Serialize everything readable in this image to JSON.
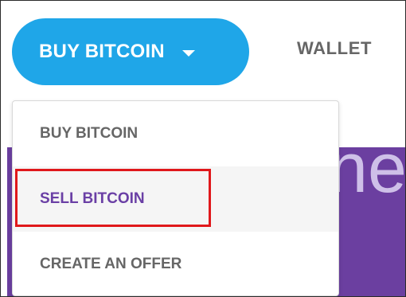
{
  "header": {
    "buy_button_label": "BUY BITCOIN",
    "wallet_label": "WALLET"
  },
  "dropdown": {
    "items": [
      {
        "label": "BUY BITCOIN"
      },
      {
        "label": "SELL BITCOIN"
      },
      {
        "label": "CREATE AN OFFER"
      }
    ],
    "highlighted_index": 1
  },
  "hero": {
    "partial_text": "ne"
  },
  "colors": {
    "accent": "#1fa6e8",
    "brand_purple": "#6b3fa0",
    "highlight_red": "#e0181b",
    "menu_text": "#666666",
    "active_text": "#6a3fa5"
  },
  "icons": {
    "buy_button": "caret-down-icon"
  }
}
